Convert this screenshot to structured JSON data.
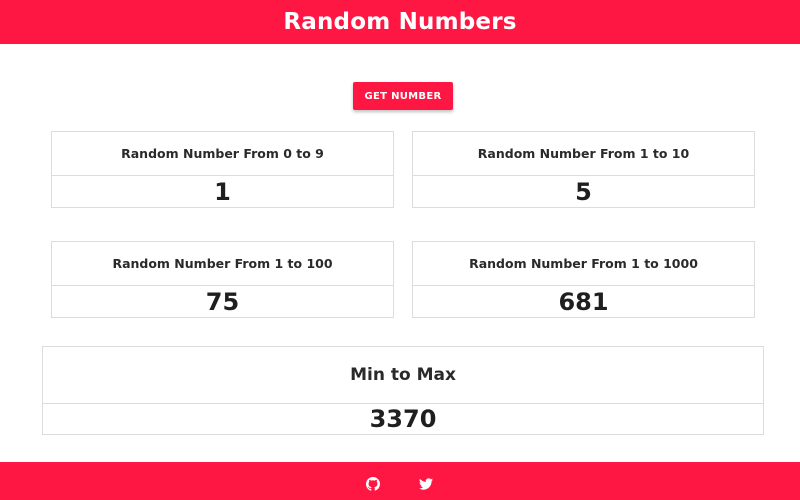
{
  "header": {
    "title": "Random Numbers"
  },
  "button": {
    "label": "GET NUMBER"
  },
  "cards": [
    {
      "title": "Random Number From 0 to 9",
      "value": "1"
    },
    {
      "title": "Random Number From 1 to 10",
      "value": "5"
    },
    {
      "title": "Random Number From 1 to 100",
      "value": "75"
    },
    {
      "title": "Random Number From 1 to 1000",
      "value": "681"
    }
  ],
  "minmax": {
    "title": "Min to Max",
    "value": "3370"
  },
  "footer": {
    "icons": [
      "github-icon",
      "twitter-icon"
    ]
  },
  "colors": {
    "accent": "#ff1744",
    "text": "#1f1f1f",
    "border": "#dcdcdc"
  }
}
